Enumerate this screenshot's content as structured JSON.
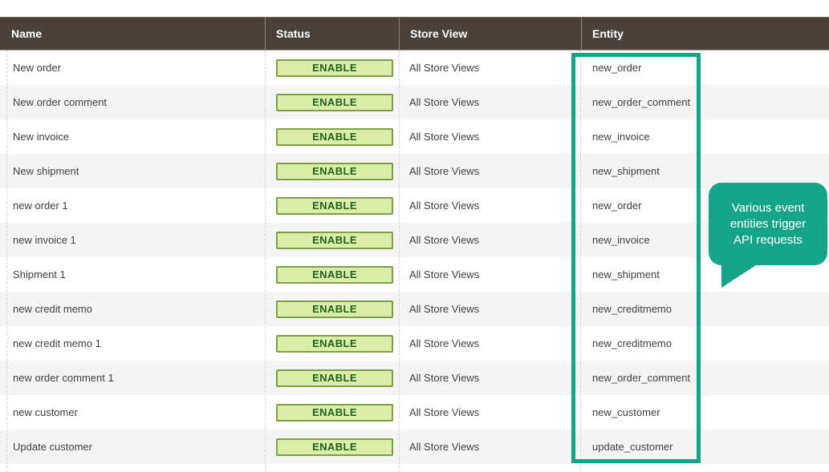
{
  "table": {
    "columns": [
      {
        "key": "name",
        "label": "Name"
      },
      {
        "key": "status",
        "label": "Status"
      },
      {
        "key": "store_view",
        "label": "Store View"
      },
      {
        "key": "entity",
        "label": "Entity"
      }
    ],
    "rows": [
      {
        "name": "New order",
        "status": "ENABLE",
        "store_view": "All Store Views",
        "entity": "new_order"
      },
      {
        "name": "New order comment",
        "status": "ENABLE",
        "store_view": "All Store Views",
        "entity": "new_order_comment"
      },
      {
        "name": "New invoice",
        "status": "ENABLE",
        "store_view": "All Store Views",
        "entity": "new_invoice"
      },
      {
        "name": "New shipment",
        "status": "ENABLE",
        "store_view": "All Store Views",
        "entity": "new_shipment"
      },
      {
        "name": "new order 1",
        "status": "ENABLE",
        "store_view": "All Store Views",
        "entity": "new_order"
      },
      {
        "name": "new invoice 1",
        "status": "ENABLE",
        "store_view": "All Store Views",
        "entity": "new_invoice"
      },
      {
        "name": "Shipment 1",
        "status": "ENABLE",
        "store_view": "All Store Views",
        "entity": "new_shipment"
      },
      {
        "name": "new credit memo",
        "status": "ENABLE",
        "store_view": "All Store Views",
        "entity": "new_creditmemo"
      },
      {
        "name": "new credit memo 1",
        "status": "ENABLE",
        "store_view": "All Store Views",
        "entity": "new_creditmemo"
      },
      {
        "name": "new order comment 1",
        "status": "ENABLE",
        "store_view": "All Store Views",
        "entity": "new_order_comment"
      },
      {
        "name": "new customer",
        "status": "ENABLE",
        "store_view": "All Store Views",
        "entity": "new_customer"
      },
      {
        "name": "Update customer",
        "status": "ENABLE",
        "store_view": "All Store Views",
        "entity": "update_customer"
      }
    ]
  },
  "callout": {
    "lines": [
      "Various event",
      "entities trigger",
      "API requests"
    ]
  },
  "colors": {
    "header_bg": "#4a423a",
    "header_text": "#ffffff",
    "row_alt_bg": "#f5f5f5",
    "row_text": "#3e4145",
    "button_bg": "#dcedaa",
    "button_border": "#7ea242",
    "button_text": "#1d641d",
    "accent_teal": "#16a489",
    "divider_dashed": "#d7d5d2"
  }
}
